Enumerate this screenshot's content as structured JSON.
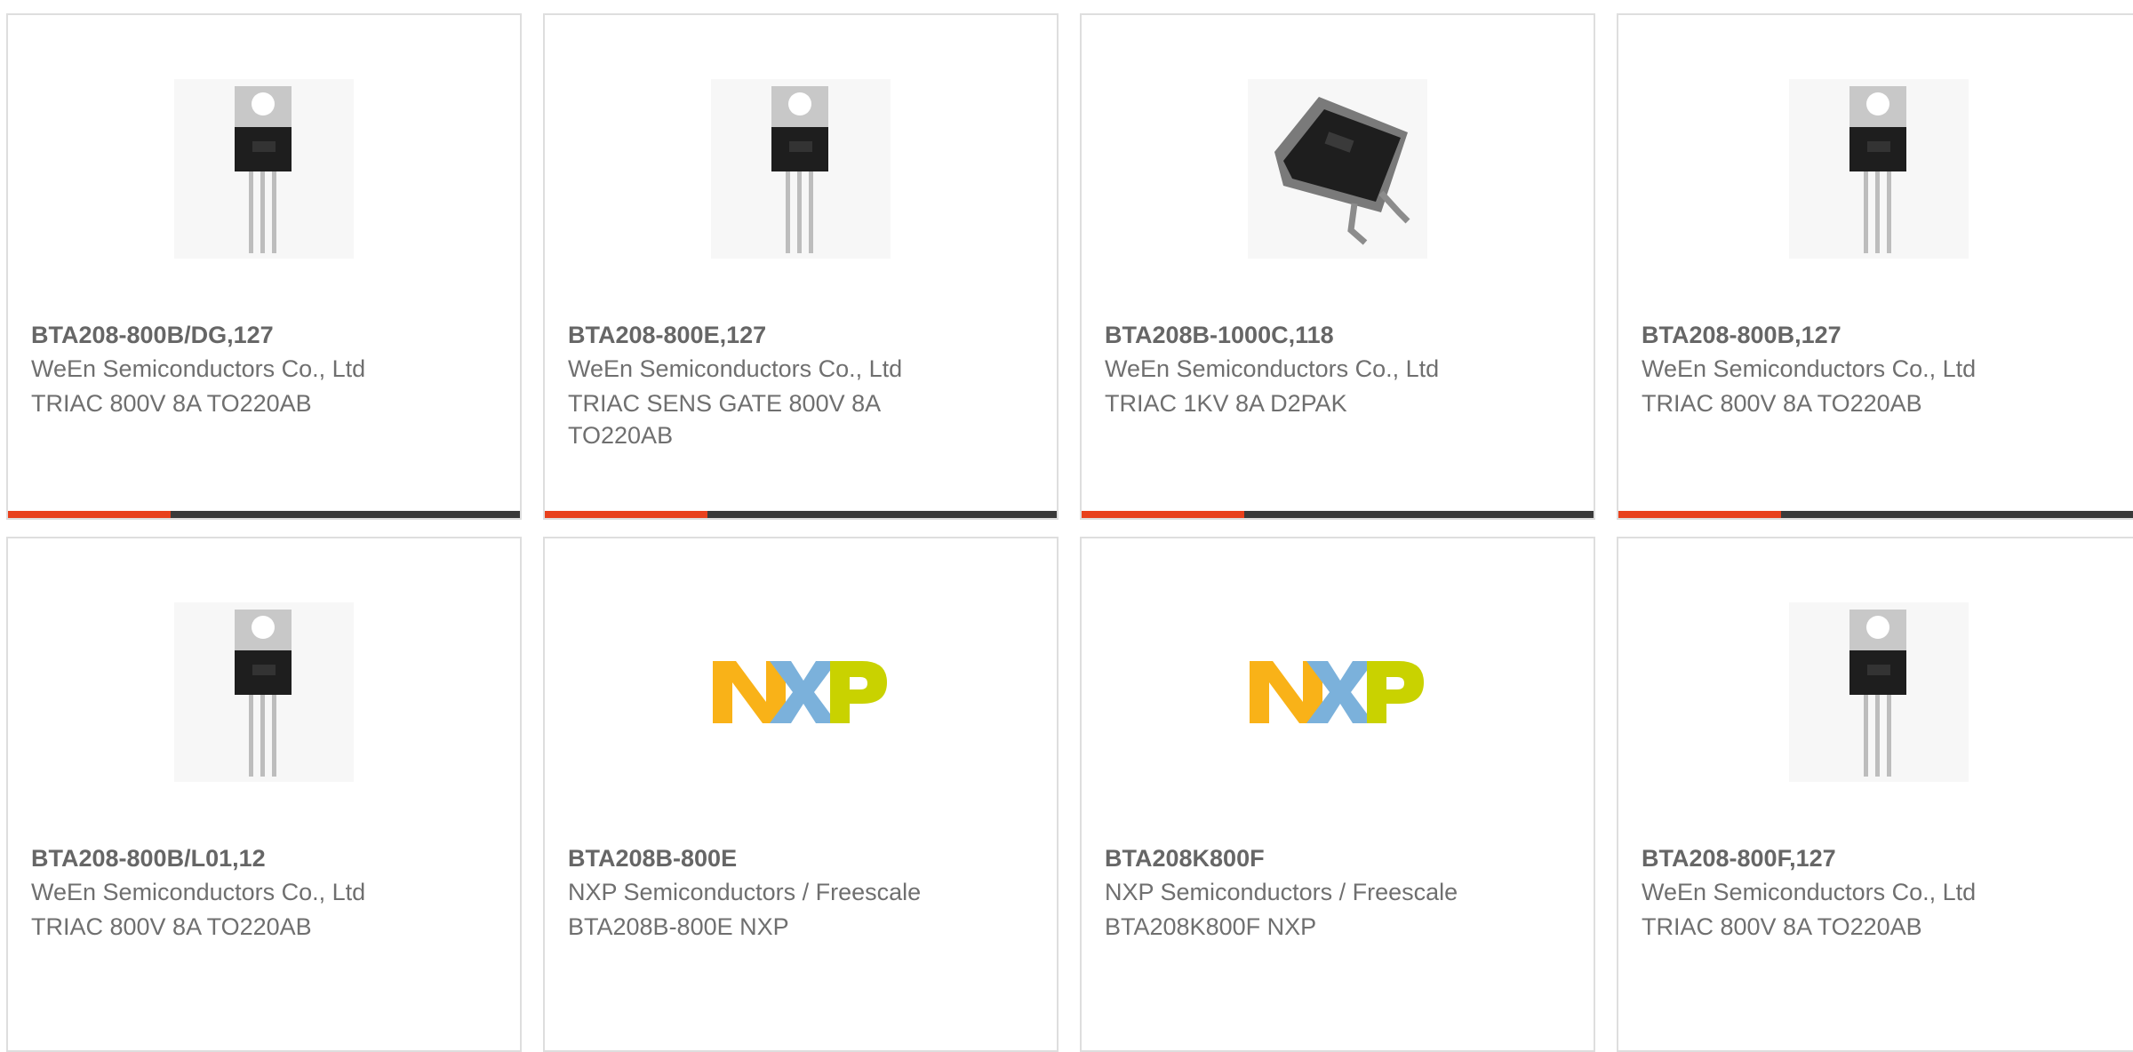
{
  "colors": {
    "accent": "#e8401c",
    "bar_dark": "#3a3a3a",
    "border": "#dedede",
    "nxp_orange": "#f9b218",
    "nxp_blue": "#7bb1db",
    "nxp_green": "#c9d200"
  },
  "products": [
    {
      "part_number": "BTA208-800B/DG,127",
      "manufacturer": "WeEn Semiconductors Co., Ltd",
      "description": "TRIAC 800V 8A TO220AB",
      "image": "to220-package",
      "image_icon": "to220-transistor-icon"
    },
    {
      "part_number": "BTA208-800E,127",
      "manufacturer": "WeEn Semiconductors Co., Ltd",
      "description": "TRIAC SENS GATE 800V 8A TO220AB",
      "image": "to220-package",
      "image_icon": "to220-transistor-icon"
    },
    {
      "part_number": "BTA208B-1000C,118",
      "manufacturer": "WeEn Semiconductors Co., Ltd",
      "description": "TRIAC 1KV 8A D2PAK",
      "image": "d2pak-package",
      "image_icon": "d2pak-transistor-icon"
    },
    {
      "part_number": "BTA208-800B,127",
      "manufacturer": "WeEn Semiconductors Co., Ltd",
      "description": "TRIAC 800V 8A TO220AB",
      "image": "to220-package",
      "image_icon": "to220-transistor-icon"
    },
    {
      "part_number": "BTA208-800B/L01,12",
      "manufacturer": "WeEn Semiconductors Co., Ltd",
      "description": "TRIAC 800V 8A TO220AB",
      "image": "to220-package",
      "image_icon": "to220-transistor-icon"
    },
    {
      "part_number": "BTA208B-800E",
      "manufacturer": "NXP Semiconductors / Freescale",
      "description": "BTA208B-800E NXP",
      "image": "nxp-logo",
      "image_icon": "nxp-logo-icon"
    },
    {
      "part_number": "BTA208K800F",
      "manufacturer": "NXP Semiconductors / Freescale",
      "description": "BTA208K800F NXP",
      "image": "nxp-logo",
      "image_icon": "nxp-logo-icon"
    },
    {
      "part_number": "BTA208-800F,127",
      "manufacturer": "WeEn Semiconductors Co., Ltd",
      "description": "TRIAC 800V 8A TO220AB",
      "image": "to220-package",
      "image_icon": "to220-transistor-icon"
    }
  ]
}
